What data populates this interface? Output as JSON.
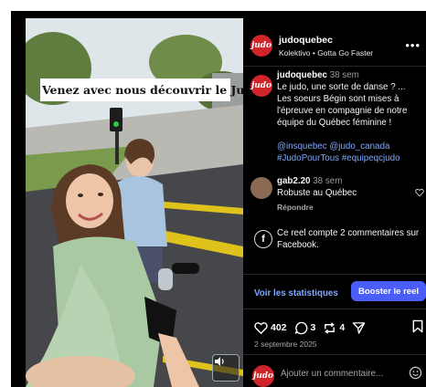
{
  "media": {
    "overlay_caption": "Venez avec nous découvrir le Judo!",
    "mute_icon": "speaker-icon"
  },
  "header": {
    "username": "judoquebec",
    "subtitle": "Kolektivo • Gotta Go Faster",
    "avatar_text": "judo",
    "more_icon": "more-dots-icon"
  },
  "post": {
    "username": "judoquebec",
    "time": "38 sem",
    "body": "Le judo, une sorte de danse ? ... Les soeurs Bégin sont mises à l'épreuve en compagnie de notre équipe du Québec féminine !",
    "tags": "@insquebec @judo_canada #JudoPourTous #equipeqcjudo"
  },
  "comments": [
    {
      "username": "gab2.20",
      "time": "38 sem",
      "text": "Robuste au Québec",
      "reply_label": "Répondre"
    }
  ],
  "facebook_note": "Ce reel compte 2 commentaires sur Facebook.",
  "footer": {
    "stats_link": "Voir les statistiques",
    "boost_button": "Booster le reel",
    "likes": "402",
    "comments_count": "3",
    "reposts": "4",
    "date": "2 septembre 2025",
    "add_comment_placeholder": "Ajouter un commentaire..."
  },
  "colors": {
    "accent_blue": "#4a5df9",
    "link_blue": "#7fa8ff",
    "brand_red": "#d0242b"
  }
}
